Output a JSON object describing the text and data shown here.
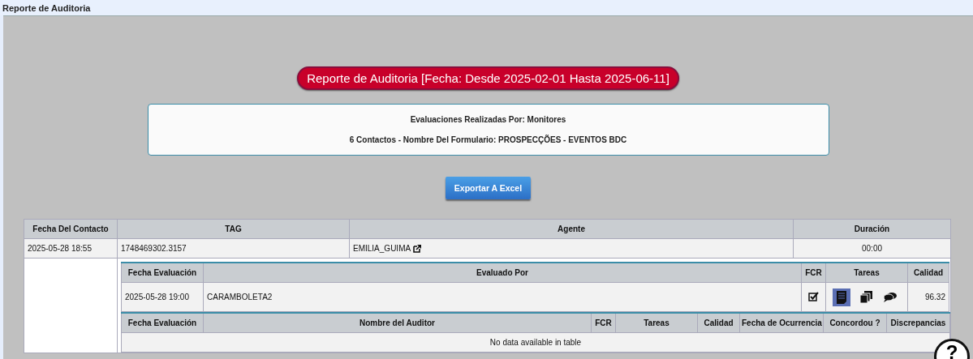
{
  "window": {
    "title": "Reporte de Auditoria"
  },
  "report_title": "Reporte de Auditoria [Fecha: Desde 2025-02-01 Hasta 2025-06-11]",
  "info": [
    "Evaluaciones Realizadas Por: Monitores",
    "6 Contactos - Nombre Del Formulario: PROSPECÇÕES - EVENTOS BDC"
  ],
  "export_button": "Exportar A Excel",
  "contacts_table": {
    "columns": [
      "Fecha Del Contacto",
      "TAG",
      "Agente",
      "Duración"
    ],
    "rows": [
      {
        "fecha": "2025-05-28 18:55",
        "tag": "1748469302.3157",
        "agente": "EMILIA_GUIMA",
        "duracion": "00:00",
        "evaluations": {
          "columns": [
            "Fecha Evaluación",
            "Evaluado Por",
            "FCR",
            "Tareas",
            "Calidad"
          ],
          "rows": [
            {
              "fecha": "2025-05-28 19:00",
              "evaluado_por": "CARAMBOLETA2",
              "fcr": true,
              "tareas": [
                {
                  "kind": "document",
                  "selected": true
                },
                {
                  "kind": "copies",
                  "selected": false
                },
                {
                  "kind": "comments",
                  "selected": false
                }
              ],
              "calidad": "96.32"
            }
          ]
        },
        "audits": {
          "columns": [
            "Fecha Evaluación",
            "Nombre del Auditor",
            "FCR",
            "Tareas",
            "Calidad",
            "Fecha de Ocurrencia",
            "Concordou ?",
            "Discrepancias"
          ],
          "empty_message": "No data available in table"
        }
      }
    ]
  },
  "help_button": "?"
}
